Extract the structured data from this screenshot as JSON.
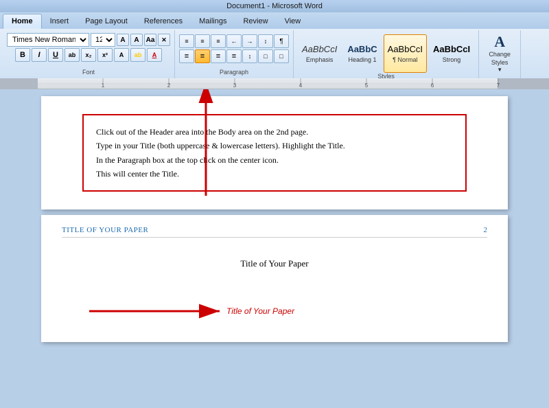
{
  "titleBar": {
    "text": "Document1 - Microsoft Word"
  },
  "ribbon": {
    "tabs": [
      "Home",
      "Insert",
      "Page Layout",
      "References",
      "Mailings",
      "Review",
      "View"
    ],
    "activeTab": "Home",
    "fontGroup": {
      "label": "Font",
      "fontName": "Times New Roman",
      "fontSize": "12",
      "boldLabel": "B",
      "italicLabel": "I",
      "underlineLabel": "U",
      "subscriptLabel": "x₂",
      "superscriptLabel": "x²",
      "changeCaseLabel": "Aa",
      "highlightLabel": "ab",
      "fontColorLabel": "A"
    },
    "paragraphGroup": {
      "label": "Paragraph",
      "bullets": "≡",
      "numbering": "≡",
      "multilevel": "≡",
      "decreaseIndent": "←",
      "increaseIndent": "→",
      "sortLabel": "↕",
      "showHide": "¶",
      "alignLeft": "☰",
      "alignCenter": "☰",
      "alignRight": "☰",
      "justify": "☰",
      "lineSpacing": "↕",
      "shading": "□",
      "border": "□"
    },
    "stylesGroup": {
      "label": "Styles",
      "items": [
        {
          "id": "emphasis",
          "preview": "AaBbCcI",
          "label": "Emphasis"
        },
        {
          "id": "heading1",
          "preview": "AaBbC",
          "label": "Heading 1"
        },
        {
          "id": "normal",
          "preview": "AaBbCcI",
          "label": "¶ Normal",
          "active": true
        },
        {
          "id": "strong",
          "preview": "AaBbCcI",
          "label": "Strong"
        }
      ]
    },
    "changeStyles": {
      "label": "Change\nStyles",
      "arrow": "▼"
    }
  },
  "instructionBox": {
    "lines": [
      "Click out of the Header area into the Body area on the 2nd page.",
      "Type in your Title (both uppercase & lowercase letters). Highlight the Title.",
      "In the Paragraph box at the top click on the center icon.",
      "This will center the Title."
    ]
  },
  "page2": {
    "headerTitle": "TITLE OF YOUR PAPER",
    "pageNumber": "2",
    "paperTitle": "Title of Your Paper",
    "arrowText": "Title of Your Paper"
  }
}
